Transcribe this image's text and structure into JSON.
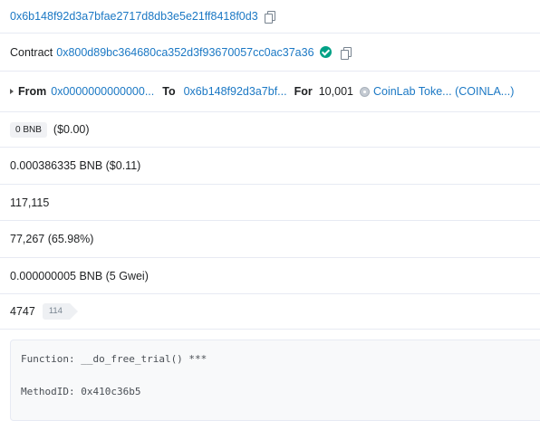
{
  "to_address": "0x6b148f92d3a7bfae2717d8db3e5e21ff8418f0d3",
  "contract": {
    "prefix": "Contract",
    "address": "0x800d89bc364680ca352d3f93670057cc0ac37a36"
  },
  "transfer": {
    "from_label": "From",
    "from_value": "0x0000000000000...",
    "to_label": "To",
    "to_value": "0x6b148f92d3a7bf...",
    "for_label": "For",
    "amount": "10,001",
    "token": "CoinLab Toke... (COINLA...)"
  },
  "value": {
    "badge": "0 BNB",
    "usd": "($0.00)"
  },
  "fee": "0.000386335 BNB ($0.11)",
  "gas_limit": "117,115",
  "gas_used": "77,267 (65.98%)",
  "gas_price": "0.000000005 BNB (5 Gwei)",
  "nonce": {
    "value": "4747",
    "position": "114"
  },
  "input_data": {
    "function_line": "Function: __do_free_trial() ***",
    "method_line": "MethodID: 0x410c36b5"
  },
  "colors": {
    "link": "#1b78c4",
    "verified": "#00a186",
    "separator": "#e7eaf3"
  },
  "icons": [
    "copy-icon",
    "verified-check-icon",
    "caret-right-icon",
    "token-icon"
  ]
}
